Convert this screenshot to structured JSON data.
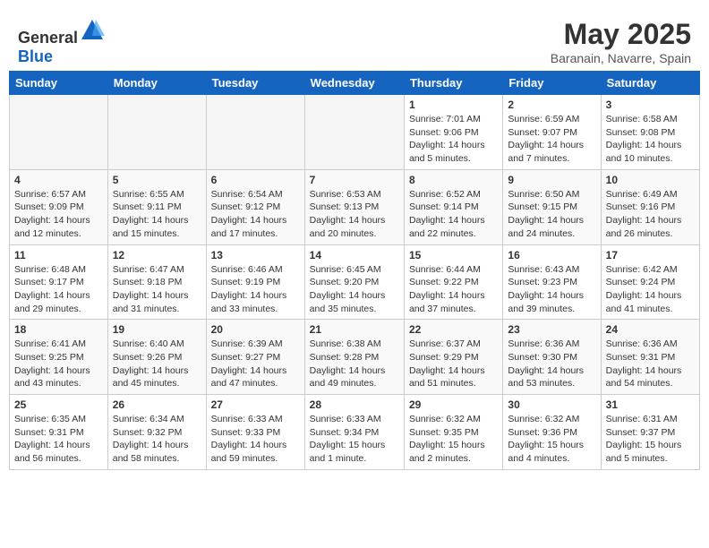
{
  "header": {
    "logo_general": "General",
    "logo_blue": "Blue",
    "month": "May 2025",
    "location": "Baranain, Navarre, Spain"
  },
  "weekdays": [
    "Sunday",
    "Monday",
    "Tuesday",
    "Wednesday",
    "Thursday",
    "Friday",
    "Saturday"
  ],
  "weeks": [
    [
      {
        "day": "",
        "info": ""
      },
      {
        "day": "",
        "info": ""
      },
      {
        "day": "",
        "info": ""
      },
      {
        "day": "",
        "info": ""
      },
      {
        "day": "1",
        "info": "Sunrise: 7:01 AM\nSunset: 9:06 PM\nDaylight: 14 hours\nand 5 minutes."
      },
      {
        "day": "2",
        "info": "Sunrise: 6:59 AM\nSunset: 9:07 PM\nDaylight: 14 hours\nand 7 minutes."
      },
      {
        "day": "3",
        "info": "Sunrise: 6:58 AM\nSunset: 9:08 PM\nDaylight: 14 hours\nand 10 minutes."
      }
    ],
    [
      {
        "day": "4",
        "info": "Sunrise: 6:57 AM\nSunset: 9:09 PM\nDaylight: 14 hours\nand 12 minutes."
      },
      {
        "day": "5",
        "info": "Sunrise: 6:55 AM\nSunset: 9:11 PM\nDaylight: 14 hours\nand 15 minutes."
      },
      {
        "day": "6",
        "info": "Sunrise: 6:54 AM\nSunset: 9:12 PM\nDaylight: 14 hours\nand 17 minutes."
      },
      {
        "day": "7",
        "info": "Sunrise: 6:53 AM\nSunset: 9:13 PM\nDaylight: 14 hours\nand 20 minutes."
      },
      {
        "day": "8",
        "info": "Sunrise: 6:52 AM\nSunset: 9:14 PM\nDaylight: 14 hours\nand 22 minutes."
      },
      {
        "day": "9",
        "info": "Sunrise: 6:50 AM\nSunset: 9:15 PM\nDaylight: 14 hours\nand 24 minutes."
      },
      {
        "day": "10",
        "info": "Sunrise: 6:49 AM\nSunset: 9:16 PM\nDaylight: 14 hours\nand 26 minutes."
      }
    ],
    [
      {
        "day": "11",
        "info": "Sunrise: 6:48 AM\nSunset: 9:17 PM\nDaylight: 14 hours\nand 29 minutes."
      },
      {
        "day": "12",
        "info": "Sunrise: 6:47 AM\nSunset: 9:18 PM\nDaylight: 14 hours\nand 31 minutes."
      },
      {
        "day": "13",
        "info": "Sunrise: 6:46 AM\nSunset: 9:19 PM\nDaylight: 14 hours\nand 33 minutes."
      },
      {
        "day": "14",
        "info": "Sunrise: 6:45 AM\nSunset: 9:20 PM\nDaylight: 14 hours\nand 35 minutes."
      },
      {
        "day": "15",
        "info": "Sunrise: 6:44 AM\nSunset: 9:22 PM\nDaylight: 14 hours\nand 37 minutes."
      },
      {
        "day": "16",
        "info": "Sunrise: 6:43 AM\nSunset: 9:23 PM\nDaylight: 14 hours\nand 39 minutes."
      },
      {
        "day": "17",
        "info": "Sunrise: 6:42 AM\nSunset: 9:24 PM\nDaylight: 14 hours\nand 41 minutes."
      }
    ],
    [
      {
        "day": "18",
        "info": "Sunrise: 6:41 AM\nSunset: 9:25 PM\nDaylight: 14 hours\nand 43 minutes."
      },
      {
        "day": "19",
        "info": "Sunrise: 6:40 AM\nSunset: 9:26 PM\nDaylight: 14 hours\nand 45 minutes."
      },
      {
        "day": "20",
        "info": "Sunrise: 6:39 AM\nSunset: 9:27 PM\nDaylight: 14 hours\nand 47 minutes."
      },
      {
        "day": "21",
        "info": "Sunrise: 6:38 AM\nSunset: 9:28 PM\nDaylight: 14 hours\nand 49 minutes."
      },
      {
        "day": "22",
        "info": "Sunrise: 6:37 AM\nSunset: 9:29 PM\nDaylight: 14 hours\nand 51 minutes."
      },
      {
        "day": "23",
        "info": "Sunrise: 6:36 AM\nSunset: 9:30 PM\nDaylight: 14 hours\nand 53 minutes."
      },
      {
        "day": "24",
        "info": "Sunrise: 6:36 AM\nSunset: 9:31 PM\nDaylight: 14 hours\nand 54 minutes."
      }
    ],
    [
      {
        "day": "25",
        "info": "Sunrise: 6:35 AM\nSunset: 9:31 PM\nDaylight: 14 hours\nand 56 minutes."
      },
      {
        "day": "26",
        "info": "Sunrise: 6:34 AM\nSunset: 9:32 PM\nDaylight: 14 hours\nand 58 minutes."
      },
      {
        "day": "27",
        "info": "Sunrise: 6:33 AM\nSunset: 9:33 PM\nDaylight: 14 hours\nand 59 minutes."
      },
      {
        "day": "28",
        "info": "Sunrise: 6:33 AM\nSunset: 9:34 PM\nDaylight: 15 hours\nand 1 minute."
      },
      {
        "day": "29",
        "info": "Sunrise: 6:32 AM\nSunset: 9:35 PM\nDaylight: 15 hours\nand 2 minutes."
      },
      {
        "day": "30",
        "info": "Sunrise: 6:32 AM\nSunset: 9:36 PM\nDaylight: 15 hours\nand 4 minutes."
      },
      {
        "day": "31",
        "info": "Sunrise: 6:31 AM\nSunset: 9:37 PM\nDaylight: 15 hours\nand 5 minutes."
      }
    ]
  ]
}
